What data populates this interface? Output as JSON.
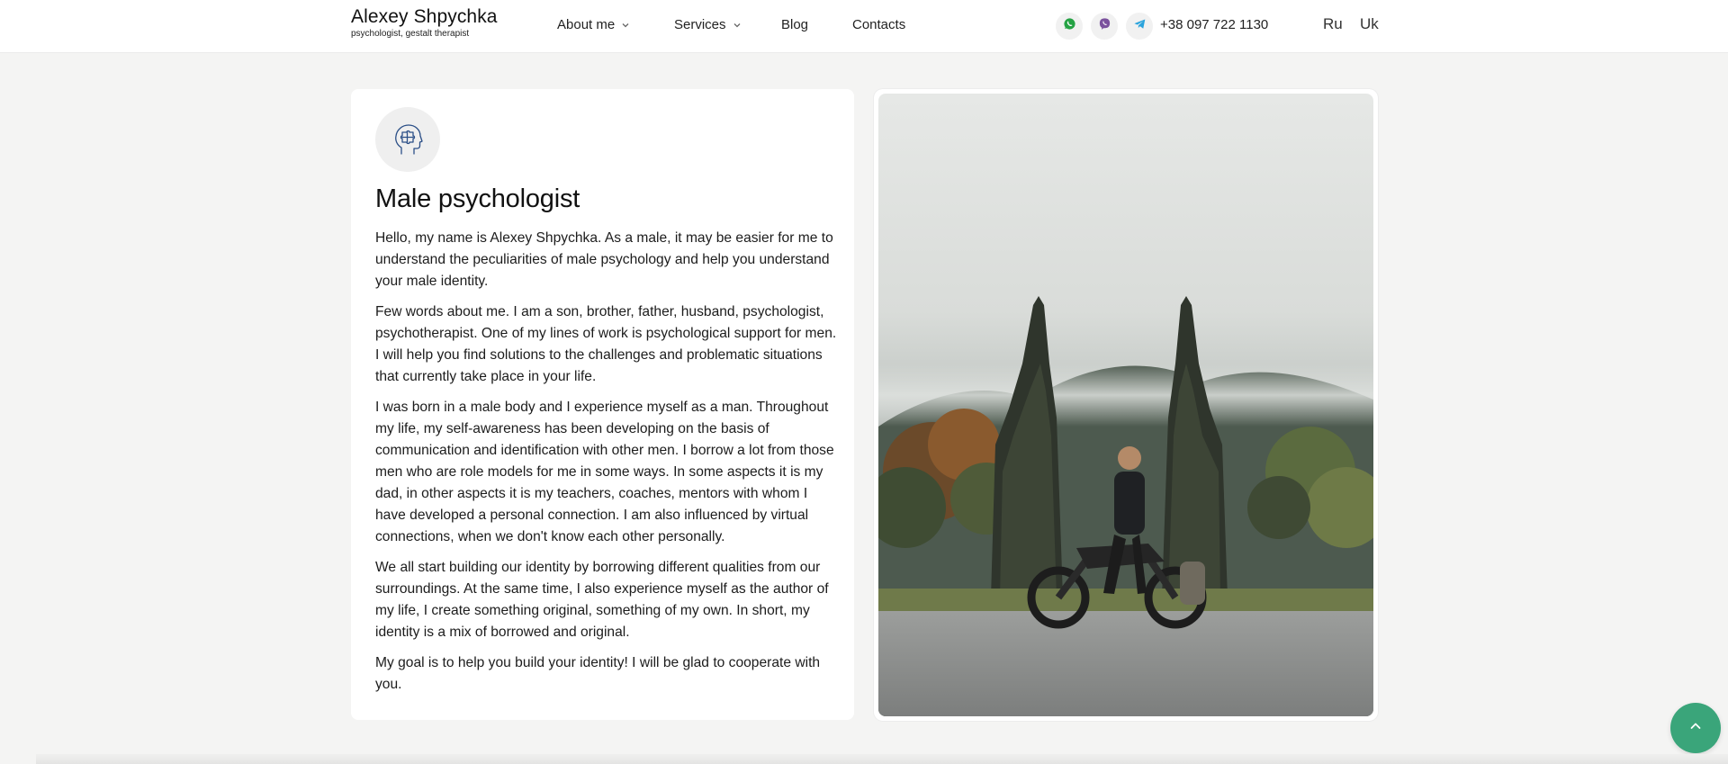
{
  "header": {
    "brand_name": "Alexey Shpychka",
    "brand_subtitle": "psychologist, gestalt therapist",
    "nav": [
      {
        "label": "About me",
        "has_dropdown": true
      },
      {
        "label": "Services",
        "has_dropdown": true
      },
      {
        "label": "Blog",
        "has_dropdown": false
      },
      {
        "label": "Contacts",
        "has_dropdown": false
      }
    ],
    "messengers": [
      {
        "icon": "whatsapp-icon",
        "color": "#25a244"
      },
      {
        "icon": "viber-icon",
        "color": "#7b519d"
      },
      {
        "icon": "telegram-icon",
        "color": "#2aa3dc"
      }
    ],
    "phone": "+38 097 722 1130",
    "languages": [
      "Ru",
      "Uk"
    ]
  },
  "card": {
    "icon": "head-puzzle-icon",
    "title": "Male psychologist",
    "paragraphs": [
      "Hello, my name is Alexey Shpychka. As a male, it may be easier for me to understand the peculiarities of male psychology and help you understand your male identity.",
      "Few words about me. I am a son, brother, father, husband, psychologist, psychotherapist. One of my lines of work is psychological support for men. I will help you find solutions to the challenges and problematic situations that currently take place in your life.",
      "I was born in a male body and I experience myself as a man. Throughout my life, my self-awareness has been developing on the basis of communication and identification with other men. I borrow a lot from those men who are role models for me in some ways. In some aspects it is my dad, in other aspects it is my teachers, coaches, mentors with whom I have developed a personal connection. I am also influenced by virtual connections, when we don't know each other personally.",
      "We all start building our identity by borrowing different qualities from our surroundings. At the same time, I also experience myself as the author of my life, I create something original, something of my own. In short, my identity is a mix of borrowed and original.",
      "My goal is to help you build your identity! I will be glad to cooperate with you."
    ]
  },
  "photo": {
    "subject": "man-on-motorcycle-photo"
  },
  "scroll_top": {
    "icon": "chevron-up-icon",
    "color": "#3aa57a"
  }
}
